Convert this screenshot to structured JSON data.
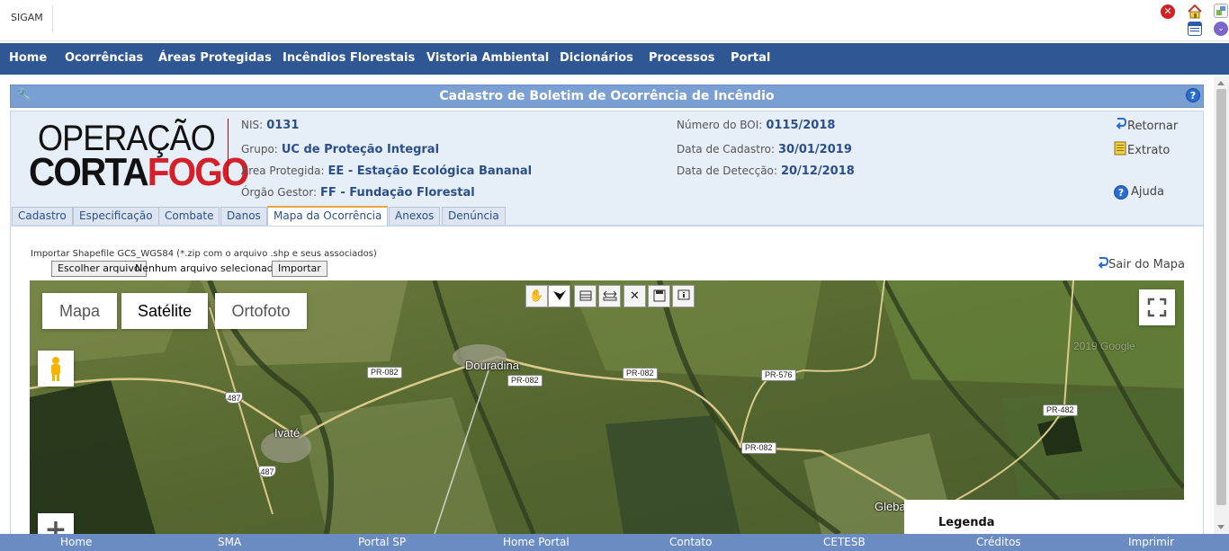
{
  "app": {
    "brand": "SIGAM"
  },
  "top_icons": [
    "close-icon",
    "home-icon",
    "broken-image-icon",
    "user-icon",
    "institution-icon",
    "calendar-icon",
    "shield-icon",
    "help-icon"
  ],
  "nav": [
    "Home",
    "Ocorrências",
    "Áreas Protegidas",
    "Incêndios Florestais",
    "Vistoria Ambiental",
    "Dicionários",
    "Processos",
    "Portal"
  ],
  "page_title": "Cadastro de Boletim de Ocorrência de Incêndio",
  "logo": {
    "line1": "OPERAÇÃO",
    "line2a": "CORTA",
    "line2b": "FOGO"
  },
  "info": {
    "nis_label": "NIS:",
    "nis": "0131",
    "grupo_label": "Grupo:",
    "grupo": "UC de Proteção Integral",
    "area_label": "Área Protegida:",
    "area": "EE - Estação Ecológica Bananal",
    "orgao_label": "Órgão Gestor:",
    "orgao": "FF - Fundação Florestal",
    "boi_label": "Número do BOI:",
    "boi": "0115/2018",
    "cadastro_label": "Data de Cadastro:",
    "cadastro": "30/01/2019",
    "deteccao_label": "Data de Detecção:",
    "deteccao": "20/12/2018"
  },
  "side_links": {
    "retornar": "Retornar",
    "extrato": "Extrato",
    "ajuda": "Ajuda"
  },
  "tabs": [
    "Cadastro",
    "Especificação",
    "Combate",
    "Danos",
    "Mapa da Ocorrência",
    "Anexos",
    "Denúncia"
  ],
  "active_tab": "Mapa da Ocorrência",
  "import": {
    "label": "Importar Shapefile GCS_WGS84 (*.zip com o arquivo .shp e seus associados)",
    "choose_button": "Escolher arquivo",
    "no_file": "Nenhum arquivo selecionado",
    "import_button": "Importar"
  },
  "sair_mapa": "Sair do Mapa",
  "map": {
    "types": [
      "Mapa",
      "Satélite",
      "Ortofoto"
    ],
    "selected_type": "Satélite",
    "tools": [
      "hand-pan-icon",
      "draw-polygon-icon",
      "measure-area-icon",
      "measure-distance-icon",
      "clear-icon",
      "save-icon",
      "info-icon"
    ],
    "places": [
      "Douradina",
      "Ivaté",
      "Gleba"
    ],
    "roads": [
      "PR-082",
      "PR-082",
      "PR-082",
      "PR-576",
      "PR-082",
      "PR-482"
    ],
    "shields": [
      "487",
      "487"
    ],
    "legend_title": "Legenda",
    "watermark": "2019 Google"
  },
  "footer": [
    "Home",
    "SMA",
    "Portal SP",
    "Home Portal",
    "Contato",
    "CETESB",
    "Créditos",
    "Imprimir"
  ]
}
